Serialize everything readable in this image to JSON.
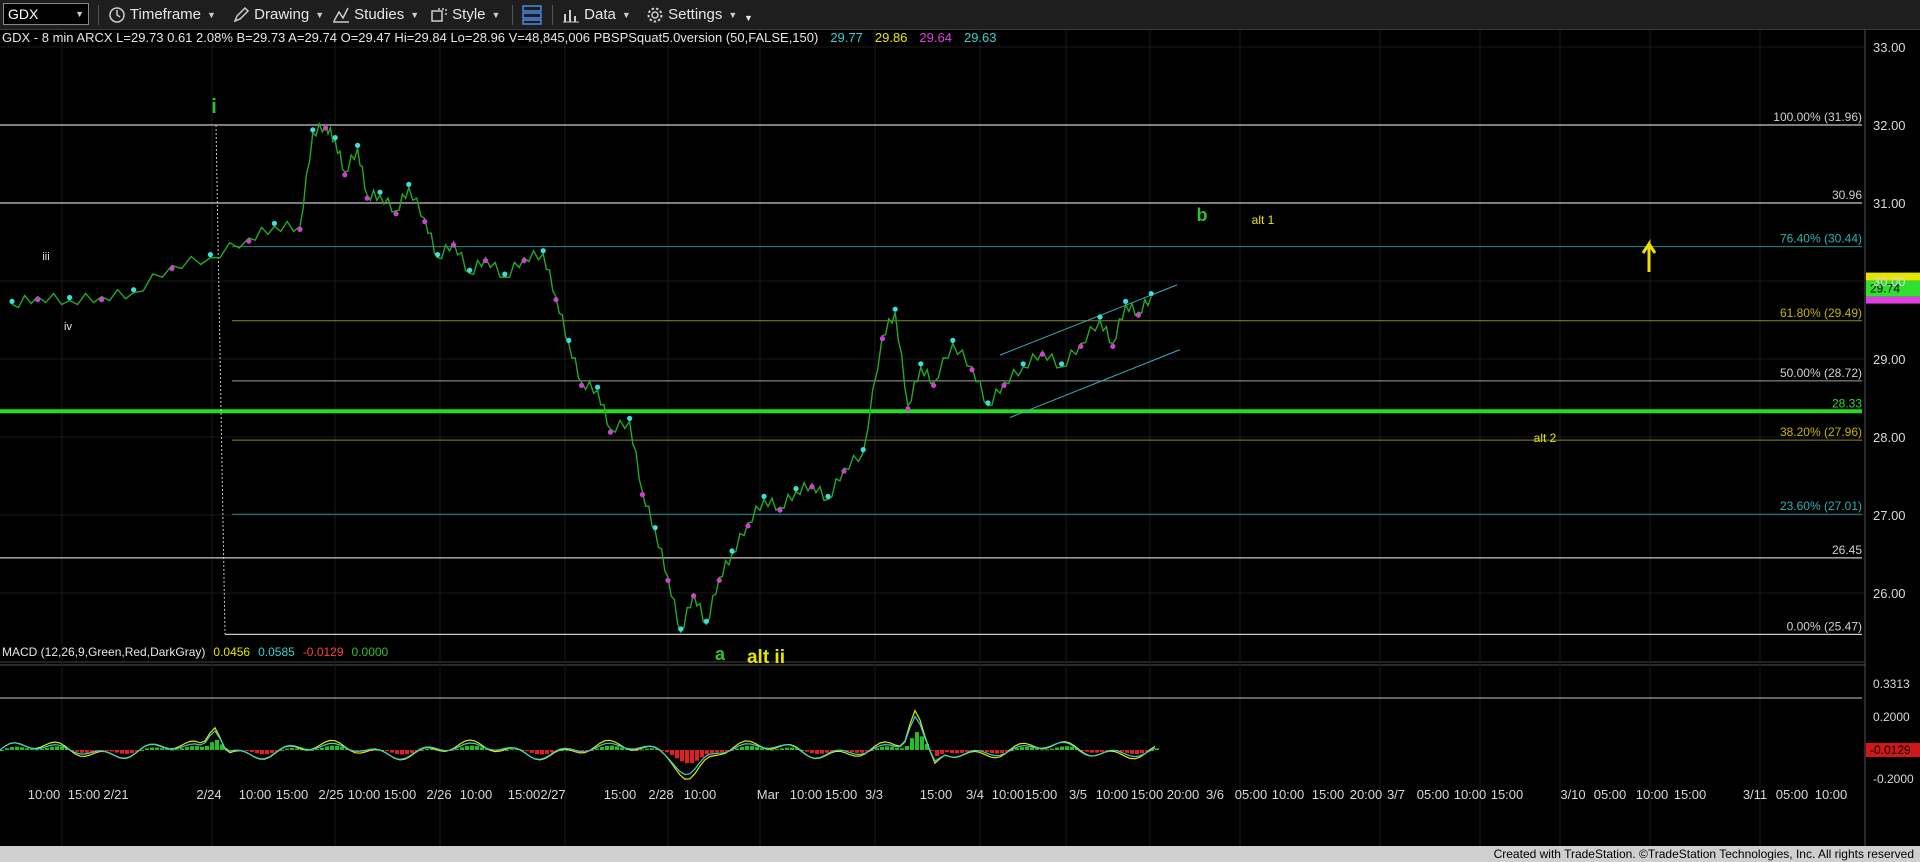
{
  "toolbar": {
    "symbol": "GDX",
    "timeframe": "Timeframe",
    "drawing": "Drawing",
    "studies": "Studies",
    "style": "Style",
    "data": "Data",
    "settings": "Settings"
  },
  "header": {
    "info_segments": [
      {
        "text": "GDX - 8 min  ARCX  L=29.73  0.61  2.08%  B=29.73  A=29.74  O=29.47  Hi=29.84  Lo=28.96  V=48,845,006  PBSPSquat5.0version (50,FALSE,150)",
        "color": "#e6e6e6"
      },
      {
        "text": "29.77",
        "color": "#36d0d0"
      },
      {
        "text": "29.86",
        "color": "#e6e600"
      },
      {
        "text": "29.64",
        "color": "#e040e0"
      },
      {
        "text": "29.63",
        "color": "#36d0d0"
      }
    ],
    "macd_segments": [
      {
        "text": "MACD (12,26,9,Green,Red,DarkGray)",
        "color": "#e6e6e6"
      },
      {
        "text": "0.0456",
        "color": "#e6e600"
      },
      {
        "text": "0.0585",
        "color": "#36d0d0"
      },
      {
        "text": "-0.0129",
        "color": "#ff4040"
      },
      {
        "text": "0.0000",
        "color": "#30c030"
      }
    ]
  },
  "chart_data": {
    "type": "line",
    "symbol": "GDX",
    "interval": "8 min",
    "price_axis": {
      "ylim": [
        25.0,
        33.1
      ],
      "ticks": [
        "33.00",
        "32.00",
        "31.00",
        "30.00",
        "29.00",
        "28.00",
        "27.00",
        "26.00"
      ],
      "last_price_label": "29.74"
    },
    "time_axis": {
      "ticks": [
        "10:00",
        "15:00",
        "2/21",
        "2/24",
        "10:00",
        "15:00",
        "2/25",
        "10:00",
        "15:00",
        "2/26",
        "10:00",
        "15:00",
        "2/27",
        "15:00",
        "2/28",
        "10:00",
        "Mar",
        "10:00",
        "15:00",
        "3/3",
        "15:00",
        "3/4",
        "10:00",
        "15:00",
        "3/5",
        "10:00",
        "15:00",
        "20:00",
        "3/6",
        "05:00",
        "10:00",
        "15:00",
        "20:00",
        "3/7",
        "05:00",
        "10:00",
        "15:00",
        "3/10",
        "05:00",
        "10:00",
        "15:00",
        "3/11",
        "05:00",
        "10:00"
      ]
    },
    "price_path": [
      [
        0,
        29.7
      ],
      [
        8,
        29.8
      ],
      [
        18,
        29.75
      ],
      [
        28,
        29.8
      ],
      [
        38,
        29.85
      ],
      [
        50,
        30.2
      ],
      [
        62,
        30.3
      ],
      [
        74,
        30.55
      ],
      [
        82,
        30.7
      ],
      [
        90,
        30.7
      ],
      [
        94,
        31.9
      ],
      [
        98,
        32.0
      ],
      [
        101,
        31.8
      ],
      [
        104,
        31.4
      ],
      [
        108,
        31.7
      ],
      [
        111,
        31.1
      ],
      [
        115,
        31.1
      ],
      [
        120,
        30.9
      ],
      [
        124,
        31.2
      ],
      [
        129,
        30.8
      ],
      [
        133,
        30.3
      ],
      [
        138,
        30.5
      ],
      [
        143,
        30.1
      ],
      [
        148,
        30.3
      ],
      [
        154,
        30.05
      ],
      [
        160,
        30.3
      ],
      [
        166,
        30.35
      ],
      [
        170,
        29.8
      ],
      [
        174,
        29.2
      ],
      [
        178,
        28.7
      ],
      [
        183,
        28.6
      ],
      [
        187,
        28.1
      ],
      [
        193,
        28.2
      ],
      [
        197,
        27.3
      ],
      [
        201,
        26.8
      ],
      [
        205,
        26.2
      ],
      [
        209,
        25.5
      ],
      [
        213,
        26.0
      ],
      [
        217,
        25.6
      ],
      [
        221,
        26.2
      ],
      [
        225,
        26.5
      ],
      [
        230,
        26.9
      ],
      [
        235,
        27.2
      ],
      [
        240,
        27.1
      ],
      [
        245,
        27.3
      ],
      [
        250,
        27.4
      ],
      [
        255,
        27.2
      ],
      [
        260,
        27.6
      ],
      [
        266,
        27.8
      ],
      [
        272,
        29.3
      ],
      [
        276,
        29.6
      ],
      [
        280,
        28.4
      ],
      [
        284,
        28.9
      ],
      [
        288,
        28.7
      ],
      [
        294,
        29.2
      ],
      [
        300,
        28.9
      ],
      [
        305,
        28.4
      ],
      [
        310,
        28.7
      ],
      [
        316,
        28.9
      ],
      [
        322,
        29.1
      ],
      [
        328,
        28.9
      ],
      [
        334,
        29.2
      ],
      [
        340,
        29.5
      ],
      [
        344,
        29.2
      ],
      [
        348,
        29.7
      ],
      [
        352,
        29.6
      ],
      [
        356,
        29.8
      ]
    ],
    "horizontal_levels": [
      {
        "price": 32.0,
        "label": "100.00% (31.96)"
      },
      {
        "price": 31.0,
        "label": "30.96"
      },
      {
        "price": 30.44,
        "label": "76.40% (30.44)"
      },
      {
        "price": 29.49,
        "label": "61.80% (29.49)"
      },
      {
        "price": 28.72,
        "label": "50.00% (28.72)"
      },
      {
        "price": 28.33,
        "label": "28.33"
      },
      {
        "price": 27.96,
        "label": "38.20% (27.96)"
      },
      {
        "price": 27.01,
        "label": "23.60% (27.01)"
      },
      {
        "price": 26.45,
        "label": "26.45"
      },
      {
        "price": 25.47,
        "label": "0.00% (25.47)"
      }
    ],
    "wave_labels": [
      {
        "text": "i",
        "color": "#30c030"
      },
      {
        "text": "iii",
        "color": "#e6e6e6"
      },
      {
        "text": "iv",
        "color": "#e6e6e6"
      },
      {
        "text": "a",
        "color": "#30c030"
      },
      {
        "text": "alt ii",
        "color": "#e6e600"
      },
      {
        "text": "b",
        "color": "#30c030"
      },
      {
        "text": "alt 1",
        "color": "#e6e600"
      },
      {
        "text": "alt 2",
        "color": "#e6e600"
      }
    ],
    "macd": {
      "ylim": [
        -0.27,
        0.33
      ],
      "ticks": [
        "0.2000",
        "-0.2000"
      ],
      "top_label": "0.3313",
      "current_label": "-0.0129",
      "macd_value": 0.0456,
      "signal_value": 0.0585,
      "histogram_value": -0.0129
    },
    "grid": true
  },
  "footer": {
    "credit": "Created with TradeStation. ©TradeStation Technologies, Inc. All rights reserved"
  }
}
